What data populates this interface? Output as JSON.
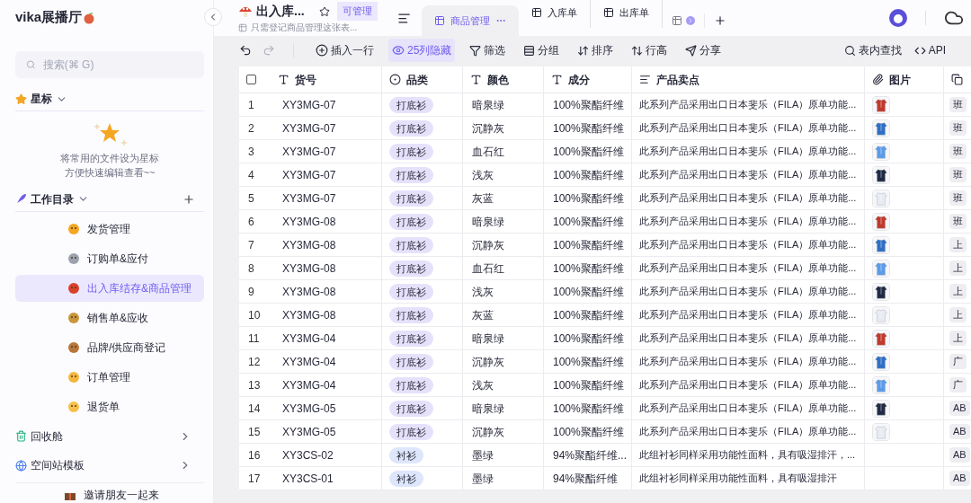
{
  "sidebar": {
    "title": "vika展播厅",
    "search": {
      "placeholder": "搜索(⌘ G)"
    },
    "starred": {
      "label": "星标",
      "empty_lines": [
        "将常用的文件设为星标",
        "方便快速编辑查看~~"
      ]
    },
    "workspace": {
      "label": "工作目录",
      "items": [
        {
          "label": "发货管理",
          "selected": false,
          "color": "#f5a623"
        },
        {
          "label": "订购单&应付",
          "selected": false,
          "color": "#9ca3af"
        },
        {
          "label": "出入库结存&商品管理",
          "selected": true,
          "color": "#d9412b"
        },
        {
          "label": "销售单&应收",
          "selected": false,
          "color": "#c9973b"
        },
        {
          "label": "品牌/供应商登记",
          "selected": false,
          "color": "#b7773a"
        },
        {
          "label": "订单管理",
          "selected": false,
          "color": "#f4b63f"
        },
        {
          "label": "退货单",
          "selected": false,
          "color": "#f7c04a"
        }
      ]
    },
    "footer_items": [
      {
        "kind": "trash",
        "label": "回收舱"
      },
      {
        "kind": "template",
        "label": "空间站模板"
      }
    ],
    "invite": "邀请朋友一起来"
  },
  "header": {
    "title": "出入库...",
    "permission": "可管理",
    "description": "只需登记商品管理这张表...",
    "tabs": [
      {
        "label": "商品管理",
        "selected": true
      },
      {
        "label": "入库单",
        "selected": false
      },
      {
        "label": "出库单",
        "selected": false
      }
    ]
  },
  "toolbar": {
    "items": [
      {
        "kind": "insert",
        "label": "插入一行",
        "active": false
      },
      {
        "kind": "hide",
        "label": "25列隐藏",
        "active": true
      },
      {
        "kind": "filter",
        "label": "筛选",
        "active": false
      },
      {
        "kind": "group",
        "label": "分组",
        "active": false
      },
      {
        "kind": "sort",
        "label": "排序",
        "active": false
      },
      {
        "kind": "height",
        "label": "行高",
        "active": false
      },
      {
        "kind": "share",
        "label": "分享",
        "active": false
      }
    ],
    "right": [
      {
        "kind": "search",
        "label": "表内查找"
      },
      {
        "kind": "api",
        "label": "API"
      }
    ]
  },
  "table": {
    "select_all": {
      "checked": false
    },
    "columns": [
      {
        "kind": "text",
        "label": "货号"
      },
      {
        "kind": "select",
        "label": "品类"
      },
      {
        "kind": "text",
        "label": "颜色"
      },
      {
        "kind": "text",
        "label": "成分"
      },
      {
        "kind": "longtext",
        "label": "产品卖点"
      },
      {
        "kind": "attachment",
        "label": "图片"
      },
      {
        "kind": "link"
      }
    ],
    "rows": [
      {
        "index": "1",
        "code": "XY3MG-07",
        "category": {
          "label": "打底衫",
          "color": "#e6e1fb"
        },
        "color_name": "暗泉绿",
        "composition": "100%聚酯纤维",
        "selling_point": "此系列产品采用出口日本斐乐（FILA）原单功能...",
        "has_image": true,
        "column_7": "班"
      },
      {
        "index": "2",
        "code": "XY3MG-07",
        "category": {
          "label": "打底衫",
          "color": "#e6e1fb"
        },
        "color_name": "沉静灰",
        "composition": "100%聚酯纤维",
        "selling_point": "此系列产品采用出口日本斐乐（FILA）原单功能...",
        "has_image": true,
        "column_7": "班"
      },
      {
        "index": "3",
        "code": "XY3MG-07",
        "category": {
          "label": "打底衫",
          "color": "#e6e1fb"
        },
        "color_name": "血石红",
        "composition": "100%聚酯纤维",
        "selling_point": "此系列产品采用出口日本斐乐（FILA）原单功能...",
        "has_image": true,
        "column_7": "班"
      },
      {
        "index": "4",
        "code": "XY3MG-07",
        "category": {
          "label": "打底衫",
          "color": "#e6e1fb"
        },
        "color_name": "浅灰",
        "composition": "100%聚酯纤维",
        "selling_point": "此系列产品采用出口日本斐乐（FILA）原单功能...",
        "has_image": true,
        "column_7": "班"
      },
      {
        "index": "5",
        "code": "XY3MG-07",
        "category": {
          "label": "打底衫",
          "color": "#e6e1fb"
        },
        "color_name": "灰蓝",
        "composition": "100%聚酯纤维",
        "selling_point": "此系列产品采用出口日本斐乐（FILA）原单功能...",
        "has_image": true,
        "column_7": "班"
      },
      {
        "index": "6",
        "code": "XY3MG-08",
        "category": {
          "label": "打底衫",
          "color": "#e6e1fb"
        },
        "color_name": "暗泉绿",
        "composition": "100%聚酯纤维",
        "selling_point": "此系列产品采用出口日本斐乐（FILA）原单功能...",
        "has_image": true,
        "column_7": "班"
      },
      {
        "index": "7",
        "code": "XY3MG-08",
        "category": {
          "label": "打底衫",
          "color": "#e6e1fb"
        },
        "color_name": "沉静灰",
        "composition": "100%聚酯纤维",
        "selling_point": "此系列产品采用出口日本斐乐（FILA）原单功能...",
        "has_image": true,
        "column_7": "上"
      },
      {
        "index": "8",
        "code": "XY3MG-08",
        "category": {
          "label": "打底衫",
          "color": "#e6e1fb"
        },
        "color_name": "血石红",
        "composition": "100%聚酯纤维",
        "selling_point": "此系列产品采用出口日本斐乐（FILA）原单功能...",
        "has_image": true,
        "column_7": "上"
      },
      {
        "index": "9",
        "code": "XY3MG-08",
        "category": {
          "label": "打底衫",
          "color": "#e6e1fb"
        },
        "color_name": "浅灰",
        "composition": "100%聚酯纤维",
        "selling_point": "此系列产品采用出口日本斐乐（FILA）原单功能...",
        "has_image": true,
        "column_7": "上"
      },
      {
        "index": "10",
        "code": "XY3MG-08",
        "category": {
          "label": "打底衫",
          "color": "#e6e1fb"
        },
        "color_name": "灰蓝",
        "composition": "100%聚酯纤维",
        "selling_point": "此系列产品采用出口日本斐乐（FILA）原单功能...",
        "has_image": true,
        "column_7": "上"
      },
      {
        "index": "11",
        "code": "XY3MG-04",
        "category": {
          "label": "打底衫",
          "color": "#e6e1fb"
        },
        "color_name": "暗泉绿",
        "composition": "100%聚酯纤维",
        "selling_point": "此系列产品采用出口日本斐乐（FILA）原单功能...",
        "has_image": true,
        "column_7": "上"
      },
      {
        "index": "12",
        "code": "XY3MG-04",
        "category": {
          "label": "打底衫",
          "color": "#e6e1fb"
        },
        "color_name": "沉静灰",
        "composition": "100%聚酯纤维",
        "selling_point": "此系列产品采用出口日本斐乐（FILA）原单功能...",
        "has_image": true,
        "column_7": "广"
      },
      {
        "index": "13",
        "code": "XY3MG-04",
        "category": {
          "label": "打底衫",
          "color": "#e6e1fb"
        },
        "color_name": "浅灰",
        "composition": "100%聚酯纤维",
        "selling_point": "此系列产品采用出口日本斐乐（FILA）原单功能...",
        "has_image": true,
        "column_7": "广"
      },
      {
        "index": "14",
        "code": "XY3MG-05",
        "category": {
          "label": "打底衫",
          "color": "#e6e1fb"
        },
        "color_name": "暗泉绿",
        "composition": "100%聚酯纤维",
        "selling_point": "此系列产品采用出口日本斐乐（FILA）原单功能...",
        "has_image": true,
        "column_7": "AB"
      },
      {
        "index": "15",
        "code": "XY3MG-05",
        "category": {
          "label": "打底衫",
          "color": "#e6e1fb"
        },
        "color_name": "沉静灰",
        "composition": "100%聚酯纤维",
        "selling_point": "此系列产品采用出口日本斐乐（FILA）原单功能...",
        "has_image": true,
        "column_7": "AB"
      },
      {
        "index": "16",
        "code": "XY3CS-02",
        "category": {
          "label": "衬衫",
          "color": "#dde6fb"
        },
        "color_name": "墨绿",
        "composition": "94%聚酯纤维...",
        "selling_point": "此组衬衫同样采用功能性面料，具有吸湿排汗，...",
        "has_image": false,
        "column_7": "AB"
      },
      {
        "index": "17",
        "code": "XY3CS-01",
        "category": {
          "label": "衬衫",
          "color": "#dde6fb"
        },
        "color_name": "墨绿",
        "composition": "94%聚酯纤维",
        "selling_point": "此组衬衫同样采用功能性面料，具有吸湿排汗",
        "has_image": false,
        "column_7": "AB"
      }
    ]
  }
}
